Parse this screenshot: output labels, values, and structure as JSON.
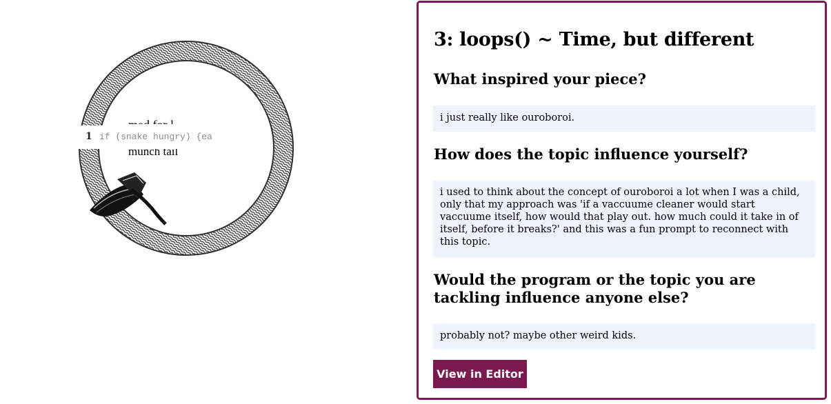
{
  "art": {
    "text_top": "med for l",
    "text_bottom": "munch tail",
    "code": {
      "line_number": "1",
      "code_text": "if (snake hungry) {ea"
    }
  },
  "card": {
    "title": "3: loops() ~ Time, but different",
    "questions": [
      {
        "question": "What inspired your piece?",
        "answer": "i just really like ouroboroi."
      },
      {
        "question": "How does the topic influence yourself?",
        "answer": "i used to think about the concept of ouroboroi a lot when I was a child, only that my approach was 'if a vaccuume cleaner would start vaccuume itself, how would that play out. how much could it take in of itself, before it breaks?' and this was a fun prompt to reconnect with this topic."
      },
      {
        "question": "Would the program or the topic you are tackling influence anyone else?",
        "answer": "probably not? maybe other weird kids."
      }
    ],
    "button_label": "View in Editor"
  },
  "colors": {
    "accent": "#7b1a4f",
    "answer_bg": "#eef3fd"
  }
}
